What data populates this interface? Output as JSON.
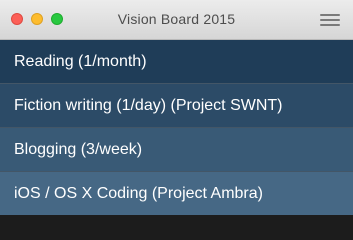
{
  "window": {
    "title": "Vision Board 2015"
  },
  "list": {
    "items": [
      {
        "label": "Reading (1/month)"
      },
      {
        "label": "Fiction writing (1/day) (Project SWNT)"
      },
      {
        "label": "Blogging (3/week)"
      },
      {
        "label": "iOS / OS X Coding (Project Ambra)"
      }
    ]
  },
  "icons": {
    "menu": "hamburger-menu-icon"
  },
  "colors": {
    "close": "#fc5f57",
    "minimize": "#fdbc2e",
    "zoom": "#28c840",
    "row_text": "#ffffff"
  }
}
